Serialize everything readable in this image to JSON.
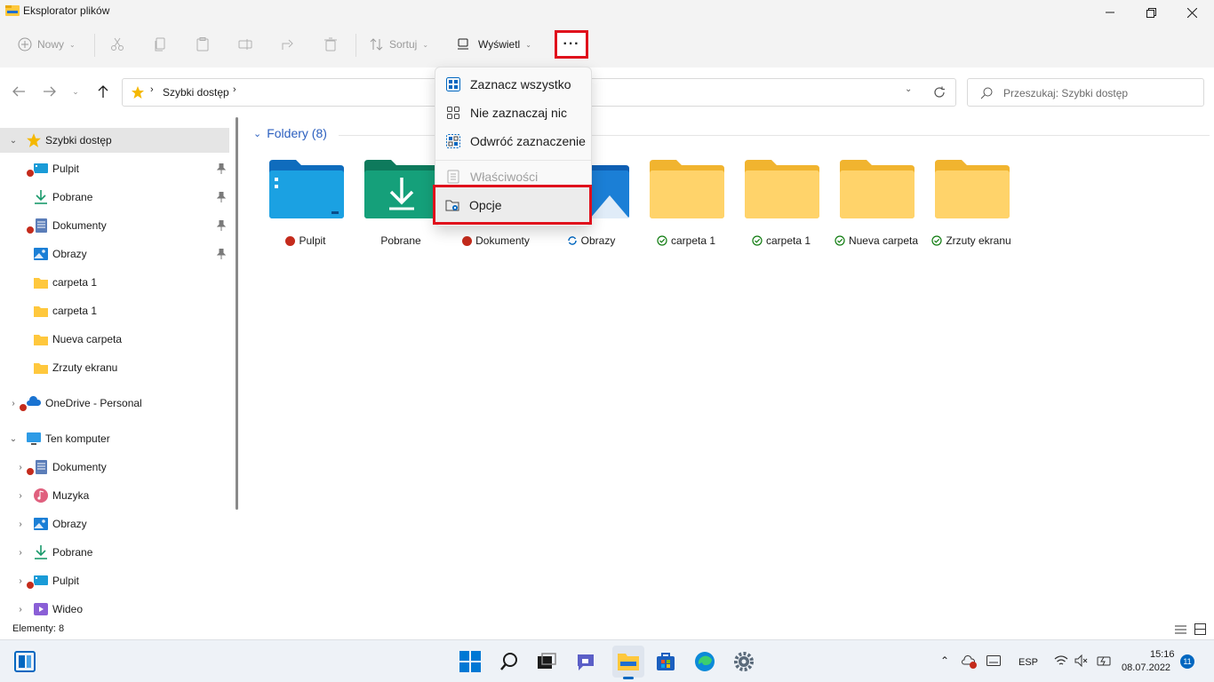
{
  "window": {
    "title": "Eksplorator plików"
  },
  "toolbar": {
    "new_label": "Nowy",
    "sort_label": "Sortuj",
    "view_label": "Wyświetl",
    "more_label": "···"
  },
  "address": {
    "crumb": "Szybki dostęp",
    "search_placeholder": "Przeszukaj: Szybki dostęp"
  },
  "menu": {
    "items": [
      {
        "label": "Zaznacz wszystko"
      },
      {
        "label": "Nie zaznaczaj nic"
      },
      {
        "label": "Odwróć zaznaczenie"
      },
      {
        "label": "Właściwości",
        "disabled": true
      },
      {
        "label": "Opcje"
      }
    ]
  },
  "nav": {
    "quick_access": "Szybki dostęp",
    "items": [
      {
        "label": "Pulpit"
      },
      {
        "label": "Pobrane"
      },
      {
        "label": "Dokumenty"
      },
      {
        "label": "Obrazy"
      },
      {
        "label": "carpeta 1"
      },
      {
        "label": "carpeta 1"
      },
      {
        "label": "Nueva carpeta"
      },
      {
        "label": "Zrzuty ekranu"
      }
    ],
    "onedrive": "OneDrive - Personal",
    "this_pc": "Ten komputer",
    "pc_items": [
      {
        "label": "Dokumenty"
      },
      {
        "label": "Muzyka"
      },
      {
        "label": "Obrazy"
      },
      {
        "label": "Pobrane"
      },
      {
        "label": "Pulpit"
      },
      {
        "label": "Wideo"
      }
    ]
  },
  "content": {
    "group_title": "Foldery (8)",
    "folders": [
      {
        "label": "Pulpit",
        "status": "error"
      },
      {
        "label": "Pobrane",
        "status": "none"
      },
      {
        "label": "Dokumenty",
        "status": "error"
      },
      {
        "label": "Obrazy",
        "status": "sync"
      },
      {
        "label": "carpeta 1",
        "status": "ok"
      },
      {
        "label": "carpeta 1",
        "status": "ok"
      },
      {
        "label": "Nueva carpeta",
        "status": "ok"
      },
      {
        "label": "Zrzuty ekranu",
        "status": "ok"
      }
    ]
  },
  "status": {
    "count": "Elementy: 8"
  },
  "tray": {
    "lang": "ESP",
    "time": "15:16",
    "date": "08.07.2022",
    "badge": "11"
  },
  "colors": {
    "accent": "#0067c0",
    "highlight": "#e0101c",
    "error": "#c42b1c",
    "ok": "#0f7b0f",
    "folder": "#ffc83d"
  }
}
